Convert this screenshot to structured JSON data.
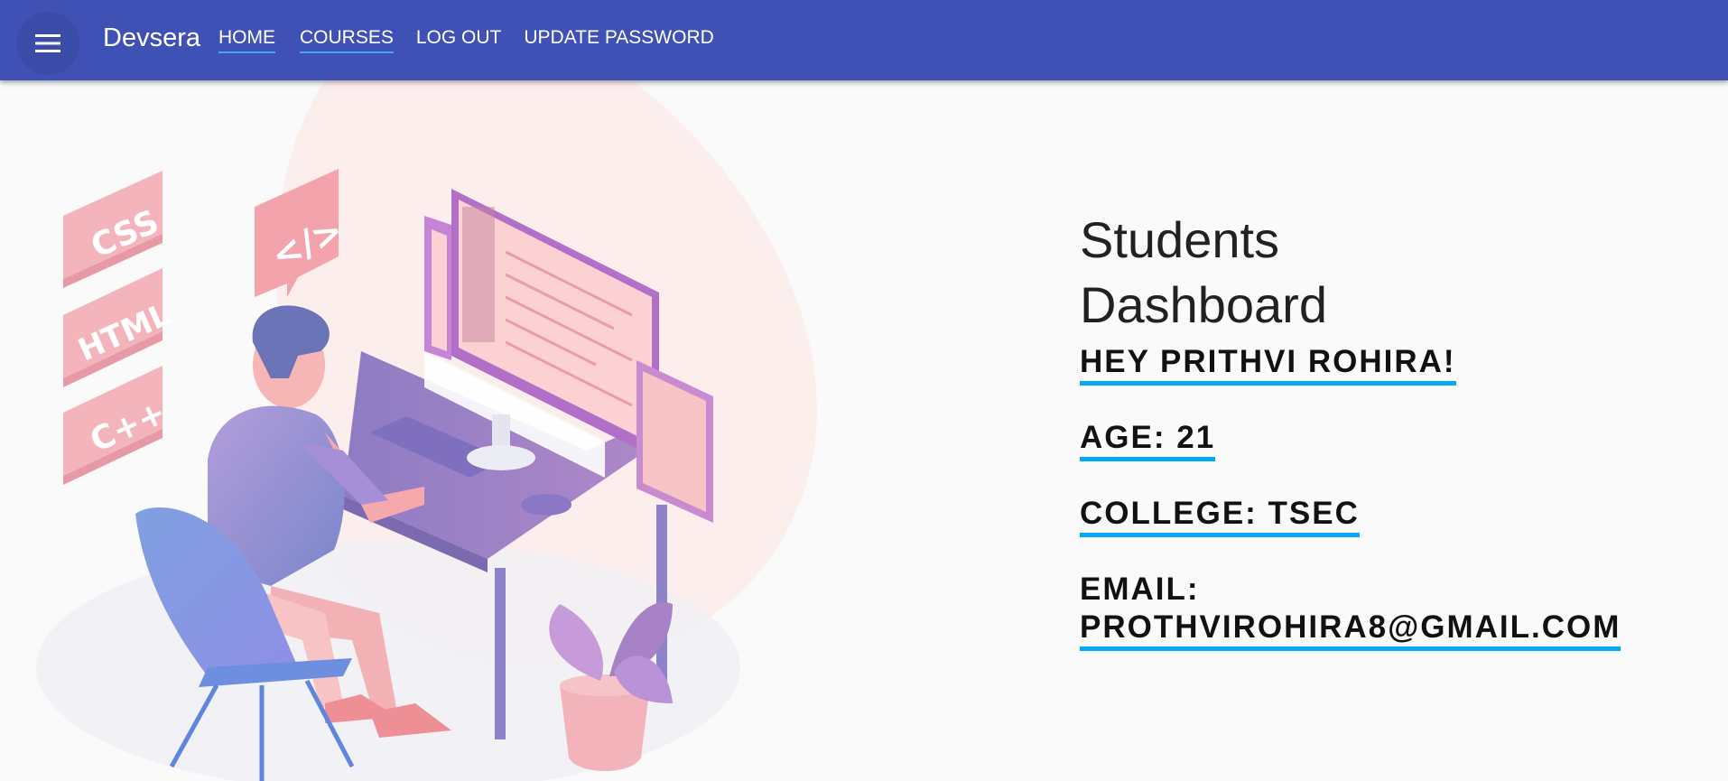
{
  "appbar": {
    "brand": "Devsera",
    "menu_icon": "hamburger-menu-icon",
    "nav": [
      "HOME",
      "COURSES",
      "LOG OUT",
      "UPDATE PASSWORD"
    ]
  },
  "illustration": {
    "badges": [
      "CSS",
      "HTML",
      "C++"
    ],
    "code_tag": "</>"
  },
  "dashboard": {
    "title_line1": "Students",
    "title_line2": "Dashboard",
    "greeting": "HEY PRITHVI ROHIRA!",
    "age": "AGE: 21",
    "college": "COLLEGE: TSEC",
    "email_label": "EMAIL:",
    "email_value": "PROTHVIROHIRA8@GMAIL.COM"
  },
  "colors": {
    "appbar": "#3f51b5",
    "underline": "#03a9f4"
  }
}
